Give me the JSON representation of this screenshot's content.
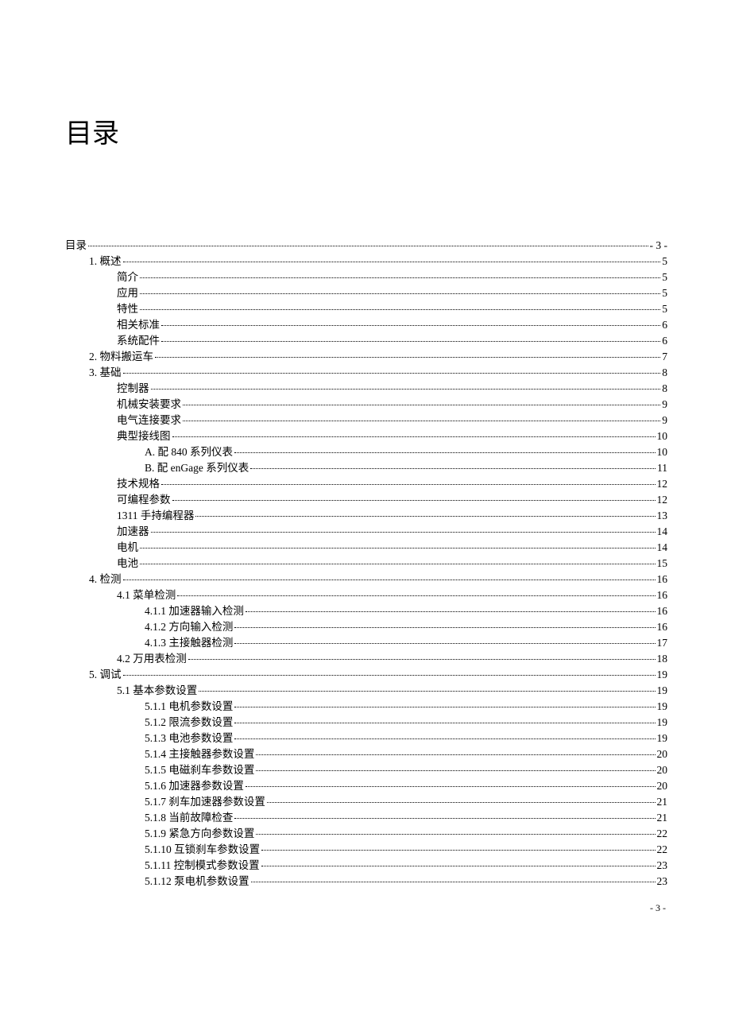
{
  "title": "目录",
  "footer_page": "- 3 -",
  "entries": [
    {
      "label": "目录",
      "page": "- 3 -",
      "indent": 0
    },
    {
      "label": "1.  概述",
      "page": "5",
      "indent": 1
    },
    {
      "label": "简介",
      "page": "5",
      "indent": 2
    },
    {
      "label": "应用",
      "page": "5",
      "indent": 2
    },
    {
      "label": "特性",
      "page": "5",
      "indent": 2
    },
    {
      "label": "相关标准",
      "page": "6",
      "indent": 2
    },
    {
      "label": "系统配件",
      "page": "6",
      "indent": 2
    },
    {
      "label": "2.  物料搬运车",
      "page": "7",
      "indent": 1
    },
    {
      "label": "3.  基础",
      "page": "8",
      "indent": 1
    },
    {
      "label": "控制器",
      "page": "8",
      "indent": 2
    },
    {
      "label": "机械安装要求",
      "page": "9",
      "indent": 2
    },
    {
      "label": "电气连接要求",
      "page": "9",
      "indent": 2
    },
    {
      "label": "典型接线图",
      "page": "10",
      "indent": 2
    },
    {
      "label": "A.  配 840 系列仪表",
      "page": "10",
      "indent": 3
    },
    {
      "label": "B.  配 enGage 系列仪表",
      "page": "11",
      "indent": 3
    },
    {
      "label": "技术规格",
      "page": "12",
      "indent": 2
    },
    {
      "label": "可编程参数",
      "page": "12",
      "indent": 2
    },
    {
      "label": "1311 手持编程器",
      "page": "13",
      "indent": 2
    },
    {
      "label": "加速器",
      "page": "14",
      "indent": 2
    },
    {
      "label": "电机",
      "page": "14",
      "indent": 2
    },
    {
      "label": "电池",
      "page": "15",
      "indent": 2
    },
    {
      "label": "4.  检测",
      "page": "16",
      "indent": 1
    },
    {
      "label": "4.1  菜单检测",
      "page": "16",
      "indent": 2
    },
    {
      "label": "4.1.1  加速器输入检测",
      "page": "16",
      "indent": 3
    },
    {
      "label": "4.1.2  方向输入检测",
      "page": "16",
      "indent": 3
    },
    {
      "label": "4.1.3  主接触器检测",
      "page": "17",
      "indent": 3
    },
    {
      "label": "4.2  万用表检测",
      "page": "18",
      "indent": 2
    },
    {
      "label": "5.  调试",
      "page": "19",
      "indent": 1
    },
    {
      "label": "5.1  基本参数设置",
      "page": "19",
      "indent": 2
    },
    {
      "label": "5.1.1  电机参数设置",
      "page": "19",
      "indent": 3
    },
    {
      "label": "5.1.2  限流参数设置",
      "page": "19",
      "indent": 3
    },
    {
      "label": "5.1.3  电池参数设置",
      "page": "19",
      "indent": 3
    },
    {
      "label": "5.1.4  主接触器参数设置",
      "page": "20",
      "indent": 3
    },
    {
      "label": "5.1.5  电磁刹车参数设置",
      "page": "20",
      "indent": 3
    },
    {
      "label": "5.1.6  加速器参数设置",
      "page": "20",
      "indent": 3
    },
    {
      "label": "5.1.7  刹车加速器参数设置",
      "page": "21",
      "indent": 3
    },
    {
      "label": "5.1.8  当前故障检查",
      "page": "21",
      "indent": 3
    },
    {
      "label": "5.1.9  紧急方向参数设置",
      "page": "22",
      "indent": 3
    },
    {
      "label": "5.1.10  互锁刹车参数设置",
      "page": "22",
      "indent": 3
    },
    {
      "label": "5.1.11  控制模式参数设置",
      "page": "23",
      "indent": 3
    },
    {
      "label": "5.1.12  泵电机参数设置",
      "page": "23",
      "indent": 3
    }
  ]
}
